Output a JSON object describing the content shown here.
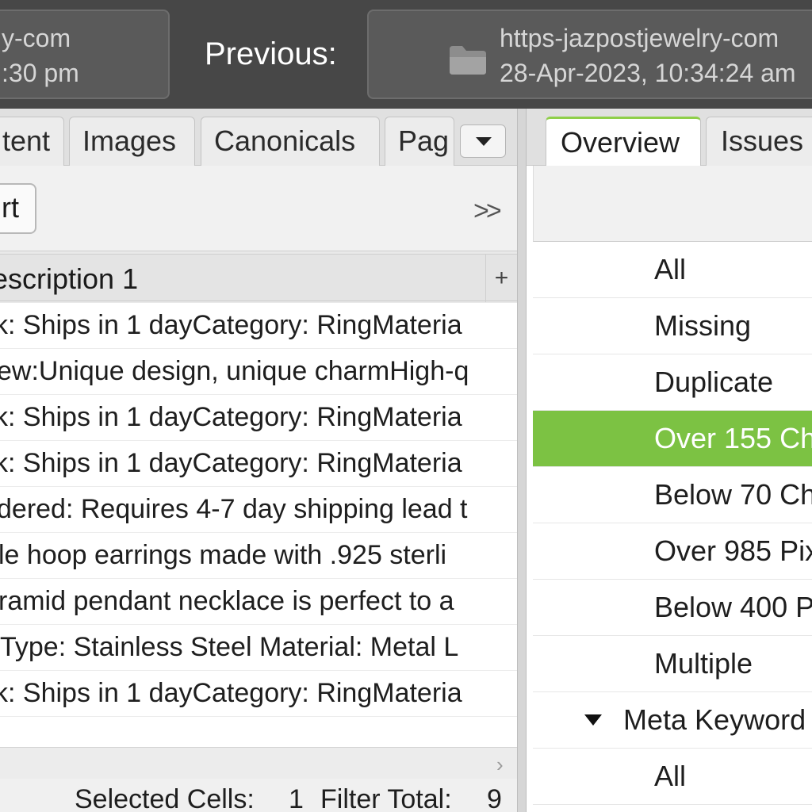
{
  "compare_bar": {
    "current_crawl": {
      "line1": "y-com",
      "line2": ":30 pm"
    },
    "previous_label": "Previous:",
    "previous_crawl": {
      "line1": "https-jazpostjewelry-com",
      "line2": "28-Apr-2023, 10:34:24 am",
      "icon": "folder-icon"
    }
  },
  "left_panel": {
    "tabs": [
      "tent",
      "Images",
      "Canonicals",
      "Pag"
    ],
    "tabs_more_icon": "dropdown-arrow-icon",
    "toolbar": {
      "export_label": "rt",
      "expand_label": ">>"
    },
    "column_header": "escription 1",
    "add_column_label": "+",
    "rows": [
      "k: Ships in 1 dayCategory: RingMateria",
      "ew:Unique design, unique charmHigh-q",
      "k: Ships in 1 dayCategory: RingMateria",
      "k: Ships in 1 dayCategory: RingMateria",
      "dered: Requires 4-7 day shipping lead t",
      "le hoop earrings made with .925 sterli",
      "ramid pendant necklace is perfect to a",
      " Type: Stainless Steel Material: Metal L",
      "k: Ships in 1 dayCategory: RingMateria"
    ],
    "hscroll_arrow": "›",
    "status": {
      "selected_label": "Selected Cells:",
      "selected_value": "1",
      "filter_label": "Filter Total:",
      "filter_value": "9"
    }
  },
  "right_panel": {
    "tabs": [
      "Overview",
      "Issues"
    ],
    "active_tab": "Overview",
    "tree": [
      {
        "label": "All",
        "level": 1,
        "selected": false
      },
      {
        "label": "Missing",
        "level": 1,
        "selected": false
      },
      {
        "label": "Duplicate",
        "level": 1,
        "selected": false
      },
      {
        "label": "Over 155 Ch",
        "level": 1,
        "selected": true
      },
      {
        "label": "Below 70 Ch",
        "level": 1,
        "selected": false
      },
      {
        "label": "Over 985 Pix",
        "level": 1,
        "selected": false
      },
      {
        "label": "Below 400 P",
        "level": 1,
        "selected": false
      },
      {
        "label": "Multiple",
        "level": 1,
        "selected": false
      },
      {
        "label": "Meta Keyword",
        "level": 0,
        "selected": false,
        "expanded": true
      },
      {
        "label": "All",
        "level": 1,
        "selected": false
      }
    ]
  },
  "colors": {
    "topbar": "#474747",
    "selection_green": "#7cc243",
    "active_tab_accent": "#8fcf4a"
  }
}
